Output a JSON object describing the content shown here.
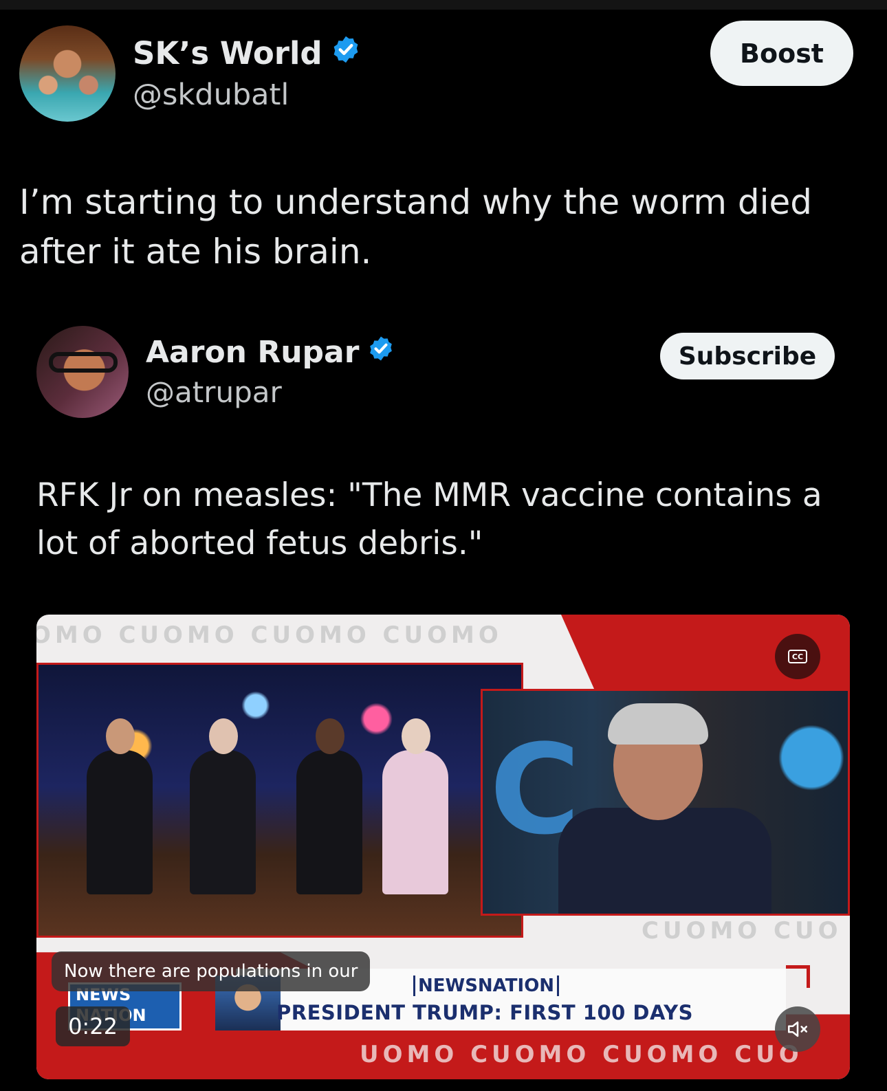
{
  "outer_post": {
    "author_name": "SK’s World",
    "handle": "@skdubatl",
    "verified": true,
    "action_label": "Boost",
    "text": "I’m starting to understand why the worm died after it ate his brain."
  },
  "quoted_post": {
    "author_name": "Aaron Rupar",
    "handle": "@atrupar",
    "verified": true,
    "action_label": "Subscribe",
    "text": "RFK Jr on measles: \"The MMR vaccine contains a lot of aborted fetus debris.\""
  },
  "video": {
    "caption": "Now there are populations in our",
    "time": "0:22",
    "cc_label": "CC",
    "overlay": {
      "watermark_top": "OMO CUOMO CUOMO CUOMO",
      "watermark_mid": "CUOMO CUO",
      "watermark_bottom": "UOMO CUOMO CUOMO CUO",
      "network_logo": "NEWS NATION",
      "network_tag": "NEWSNATION",
      "ticker": "PRESIDENT TRUMP: FIRST 100 DAYS"
    },
    "icons": {
      "cc": "closed-captions-icon",
      "mute": "volume-muted-icon"
    }
  },
  "colors": {
    "background": "#000000",
    "verified_blue": "#1d9bf0",
    "button_bg": "#eff3f4",
    "broadcast_red": "#c41a1a",
    "ticker_navy": "#1b2f6e"
  }
}
